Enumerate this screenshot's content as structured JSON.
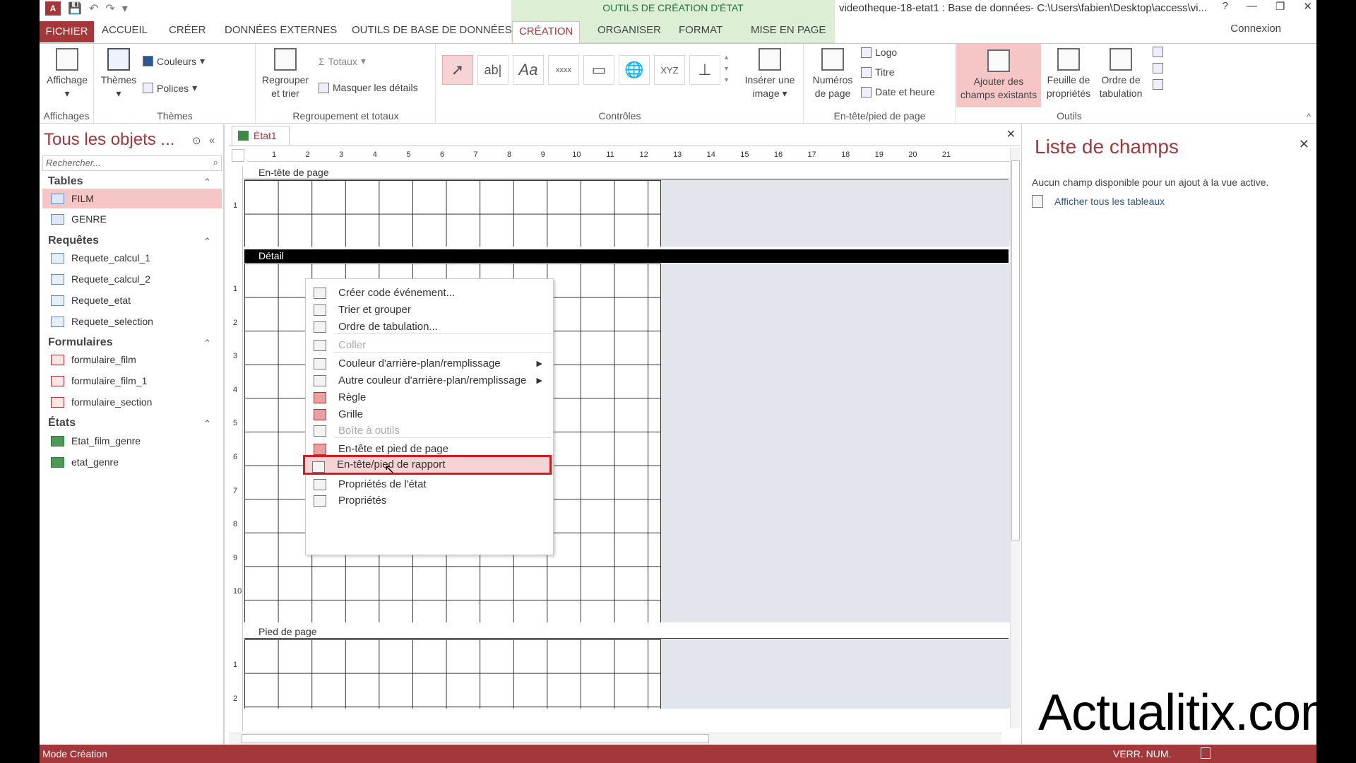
{
  "titlebar": {
    "contextual_tools": "OUTILS DE CRÉATION D'ÉTAT",
    "document_title": "videotheque-18-etat1 : Base de données- C:\\Users\\fabien\\Desktop\\access\\vi...",
    "help": "?",
    "minimize": "—",
    "restore": "❐",
    "close": "✕"
  },
  "tabs": {
    "file": "FICHIER",
    "items": [
      "ACCUEIL",
      "CRÉER",
      "DONNÉES EXTERNES",
      "OUTILS DE BASE DE DONNÉES",
      "CRÉATION",
      "ORGANISER",
      "FORMAT",
      "MISE EN PAGE"
    ],
    "active": "CRÉATION",
    "account": "Connexion"
  },
  "ribbon": {
    "affichages": {
      "title": "Affichages",
      "btn": "Affichage"
    },
    "themes": {
      "title": "Thèmes",
      "btn": "Thèmes",
      "couleurs": "Couleurs",
      "polices": "Polices"
    },
    "regroupement": {
      "title": "Regroupement et totaux",
      "regrouper": "Regrouper",
      "regrouper2": "et trier",
      "totaux": "Totaux",
      "masquer": "Masquer les détails"
    },
    "controles": {
      "title": "Contrôles",
      "text_ctrl": "ab|",
      "label_ctrl": "Aa",
      "button_ctrl": "xxxx",
      "attach_ctrl": "XYZ",
      "inserer": "Insérer une",
      "inserer2": "image"
    },
    "entete": {
      "title": "En-tête/pied de page",
      "numeros": "Numéros",
      "numeros2": "de page",
      "logo": "Logo",
      "titre": "Titre",
      "date": "Date et heure"
    },
    "outils": {
      "title": "Outils",
      "ajouter": "Ajouter des",
      "ajouter2": "champs existants",
      "feuille": "Feuille de",
      "feuille2": "propriétés",
      "ordre": "Ordre de",
      "ordre2": "tabulation"
    }
  },
  "nav": {
    "title": "Tous les objets ...",
    "search_placeholder": "Rechercher...",
    "sections": [
      {
        "label": "Tables",
        "items": [
          "FILM",
          "GENRE"
        ]
      },
      {
        "label": "Requêtes",
        "items": [
          "Requete_calcul_1",
          "Requete_calcul_2",
          "Requete_etat",
          "Requete_selection"
        ]
      },
      {
        "label": "Formulaires",
        "items": [
          "formulaire_film",
          "formulaire_film_1",
          "formulaire_section"
        ]
      },
      {
        "label": "États",
        "items": [
          "Etat_film_genre",
          "etat_genre"
        ]
      }
    ],
    "selected": "FILM"
  },
  "document": {
    "tab": "État1",
    "sections": {
      "header": "En-tête de page",
      "detail": "Détail",
      "footer": "Pied de page"
    },
    "hruler": [
      "1",
      "2",
      "3",
      "4",
      "5",
      "6",
      "7",
      "8",
      "9",
      "10",
      "11",
      "12",
      "13",
      "14",
      "15",
      "16",
      "17",
      "18",
      "19",
      "20",
      "21"
    ],
    "vruler_header": [
      "1"
    ],
    "vruler_detail": [
      "1",
      "2",
      "3",
      "4",
      "5",
      "6",
      "7",
      "8",
      "9",
      "10"
    ],
    "vruler_footer": [
      "1",
      "2"
    ]
  },
  "context_menu": {
    "items": [
      {
        "label": "Créer code événement...",
        "disabled": false,
        "submenu": false
      },
      {
        "label": "Trier et grouper",
        "disabled": false,
        "submenu": false
      },
      {
        "label": "Ordre de tabulation...",
        "disabled": false,
        "submenu": false
      },
      {
        "label": "Coller",
        "disabled": true,
        "submenu": false
      },
      {
        "label": "Couleur d'arrière-plan/remplissage",
        "disabled": false,
        "submenu": true
      },
      {
        "label": "Autre couleur d'arrière-plan/remplissage",
        "disabled": false,
        "submenu": true
      },
      {
        "label": "Règle",
        "disabled": false,
        "submenu": false
      },
      {
        "label": "Grille",
        "disabled": false,
        "submenu": false
      },
      {
        "label": "Boîte à outils",
        "disabled": true,
        "submenu": false
      },
      {
        "label": "En-tête et pied de page",
        "disabled": false,
        "submenu": false
      },
      {
        "label": "En-tête/pied de rapport",
        "disabled": false,
        "submenu": false
      },
      {
        "label": "Propriétés de l'état",
        "disabled": false,
        "submenu": false
      },
      {
        "label": "Propriétés",
        "disabled": false,
        "submenu": false
      }
    ],
    "highlighted": "En-tête/pied de rapport"
  },
  "field_list": {
    "title": "Liste de champs",
    "message": "Aucun champ disponible pour un ajout à la vue active.",
    "link": "Afficher tous les tableaux"
  },
  "watermark": "Actualitix.com",
  "status": {
    "mode": "Mode Création",
    "numlock": "VERR. NUM."
  },
  "colors": {
    "accent": "#a4373a",
    "contextual": "#dcefd5",
    "highlight": "#f6c6c7",
    "box": "#e0161e"
  }
}
